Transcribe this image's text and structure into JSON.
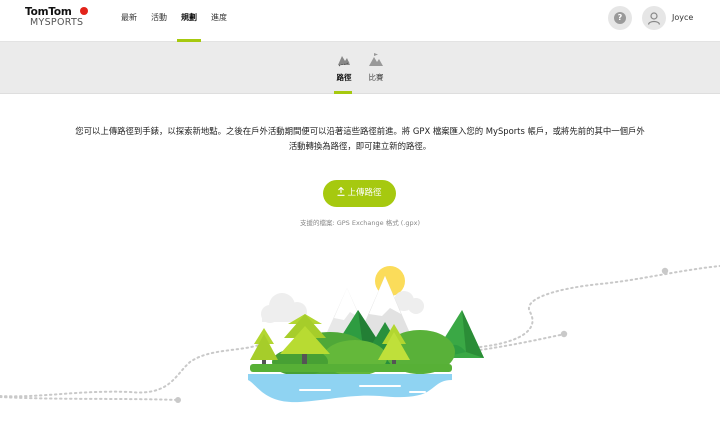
{
  "brand": {
    "name": "TomTom",
    "sub": "MYSPORTS",
    "accent": "#a6c90f",
    "logo_red": "#e2231a"
  },
  "nav": {
    "items": [
      "最新",
      "活動",
      "規劃",
      "進度"
    ],
    "active_index": 2
  },
  "user": {
    "name": "Joyce",
    "help_icon": "question-icon",
    "avatar_icon": "user-icon"
  },
  "subnav": {
    "items": [
      {
        "label": "路徑",
        "icon": "route-icon"
      },
      {
        "label": "比賽",
        "icon": "race-icon"
      }
    ],
    "active_index": 0
  },
  "main": {
    "description_line1": "您可以上傳路徑到手錶，以探索新地點。之後在戶外活動期間便可以沿著這些路徑前進。將 GPX 檔案匯入您的 MySports 帳戶，或將先前的其中一個戶外",
    "description_line2": "活動轉換為路徑，即可建立新的路徑。",
    "upload_label": "上傳路徑",
    "support_text": "支援的檔案: GPS Exchange 格式 (.gpx)"
  },
  "illustration": {
    "name": "landscape-illustration"
  }
}
